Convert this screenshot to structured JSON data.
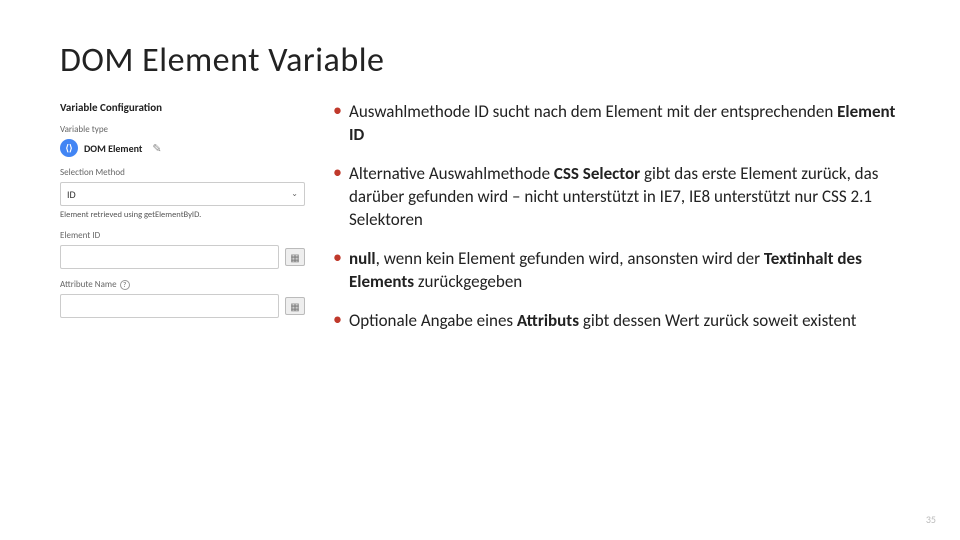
{
  "title": "DOM Element Variable",
  "panel": {
    "heading": "Variable Configuration",
    "type_label": "Variable type",
    "type_value": "DOM Element",
    "selection_label": "Selection Method",
    "selection_value": "ID",
    "selection_helper": "Element retrieved using getElementByID.",
    "element_id_label": "Element ID",
    "attribute_label": "Attribute Name"
  },
  "bullets": {
    "b1_a": "Auswahlmethode ID sucht nach dem Element mit der entsprechenden ",
    "b1_b": "Element ID",
    "b2_a": "Alternative Auswahlmethode ",
    "b2_b": "CSS Selector",
    "b2_c": " gibt das erste Element zurück, das darüber gefunden wird – nicht unterstützt in IE7, IE8 unterstützt nur CSS 2.1 Selektoren",
    "b3_a": "null",
    "b3_b": ", wenn kein Element gefunden wird, ansonsten wird der ",
    "b3_c": "Textinhalt des Elements",
    "b3_d": " zurückgegeben",
    "b4_a": "Optionale Angabe eines ",
    "b4_b": "Attributs",
    "b4_c": " gibt dessen Wert zurück soweit existent"
  },
  "icons": {
    "code": "⟨⟩",
    "pencil": "✎",
    "chev": "⌄",
    "brick": "▦",
    "q": "?"
  },
  "page": "35"
}
